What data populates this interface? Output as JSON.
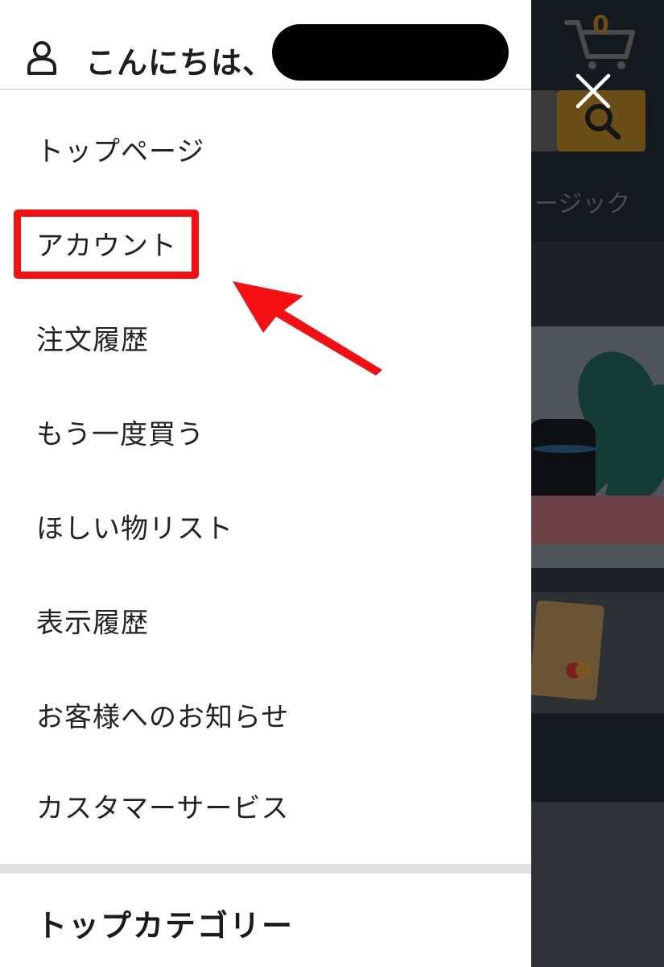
{
  "header": {
    "greeting": "こんにちは、",
    "cart_count": "0"
  },
  "background": {
    "nav_text": "ージック"
  },
  "menu": {
    "items": [
      {
        "label": "トップページ"
      },
      {
        "label": "アカウント",
        "highlighted": true
      },
      {
        "label": "注文履歴"
      },
      {
        "label": "もう一度買う"
      },
      {
        "label": "ほしい物リスト"
      },
      {
        "label": "表示履歴"
      },
      {
        "label": "お客様へのお知らせ"
      },
      {
        "label": "カスタマーサービス"
      }
    ]
  },
  "section": {
    "heading": "トップカテゴリー"
  },
  "colors": {
    "annotation": "#f50e12",
    "drawer_bg": "#ffffff",
    "overlay_bg": "#1d2127",
    "accent_dim": "#6b4e17"
  }
}
